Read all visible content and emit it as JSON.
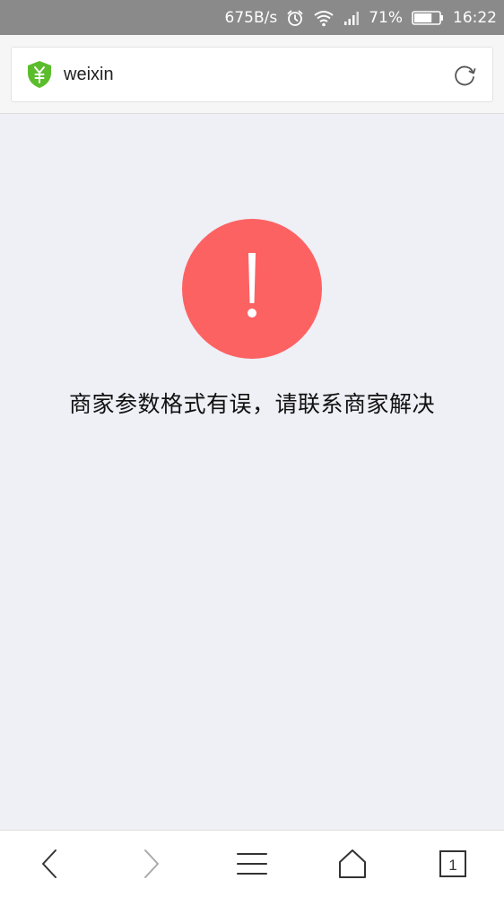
{
  "status_bar": {
    "network_speed": "675B/s",
    "battery_percent": "71%",
    "time": "16:22",
    "battery_level": 0.71,
    "icons": [
      "alarm-icon",
      "wifi-icon",
      "signal-icon",
      "battery-icon"
    ]
  },
  "address_bar": {
    "url": "weixin",
    "secure_icon": "yuan-shield-icon",
    "refresh_icon": "refresh-icon"
  },
  "main": {
    "alert_icon": "exclamation-icon",
    "alert_color": "#fd6262",
    "error_message": "商家参数格式有误，请联系商家解决"
  },
  "bottom_nav": {
    "tab_count": "1",
    "items": [
      "back-icon",
      "forward-icon",
      "menu-icon",
      "home-icon",
      "tabs-icon"
    ]
  }
}
